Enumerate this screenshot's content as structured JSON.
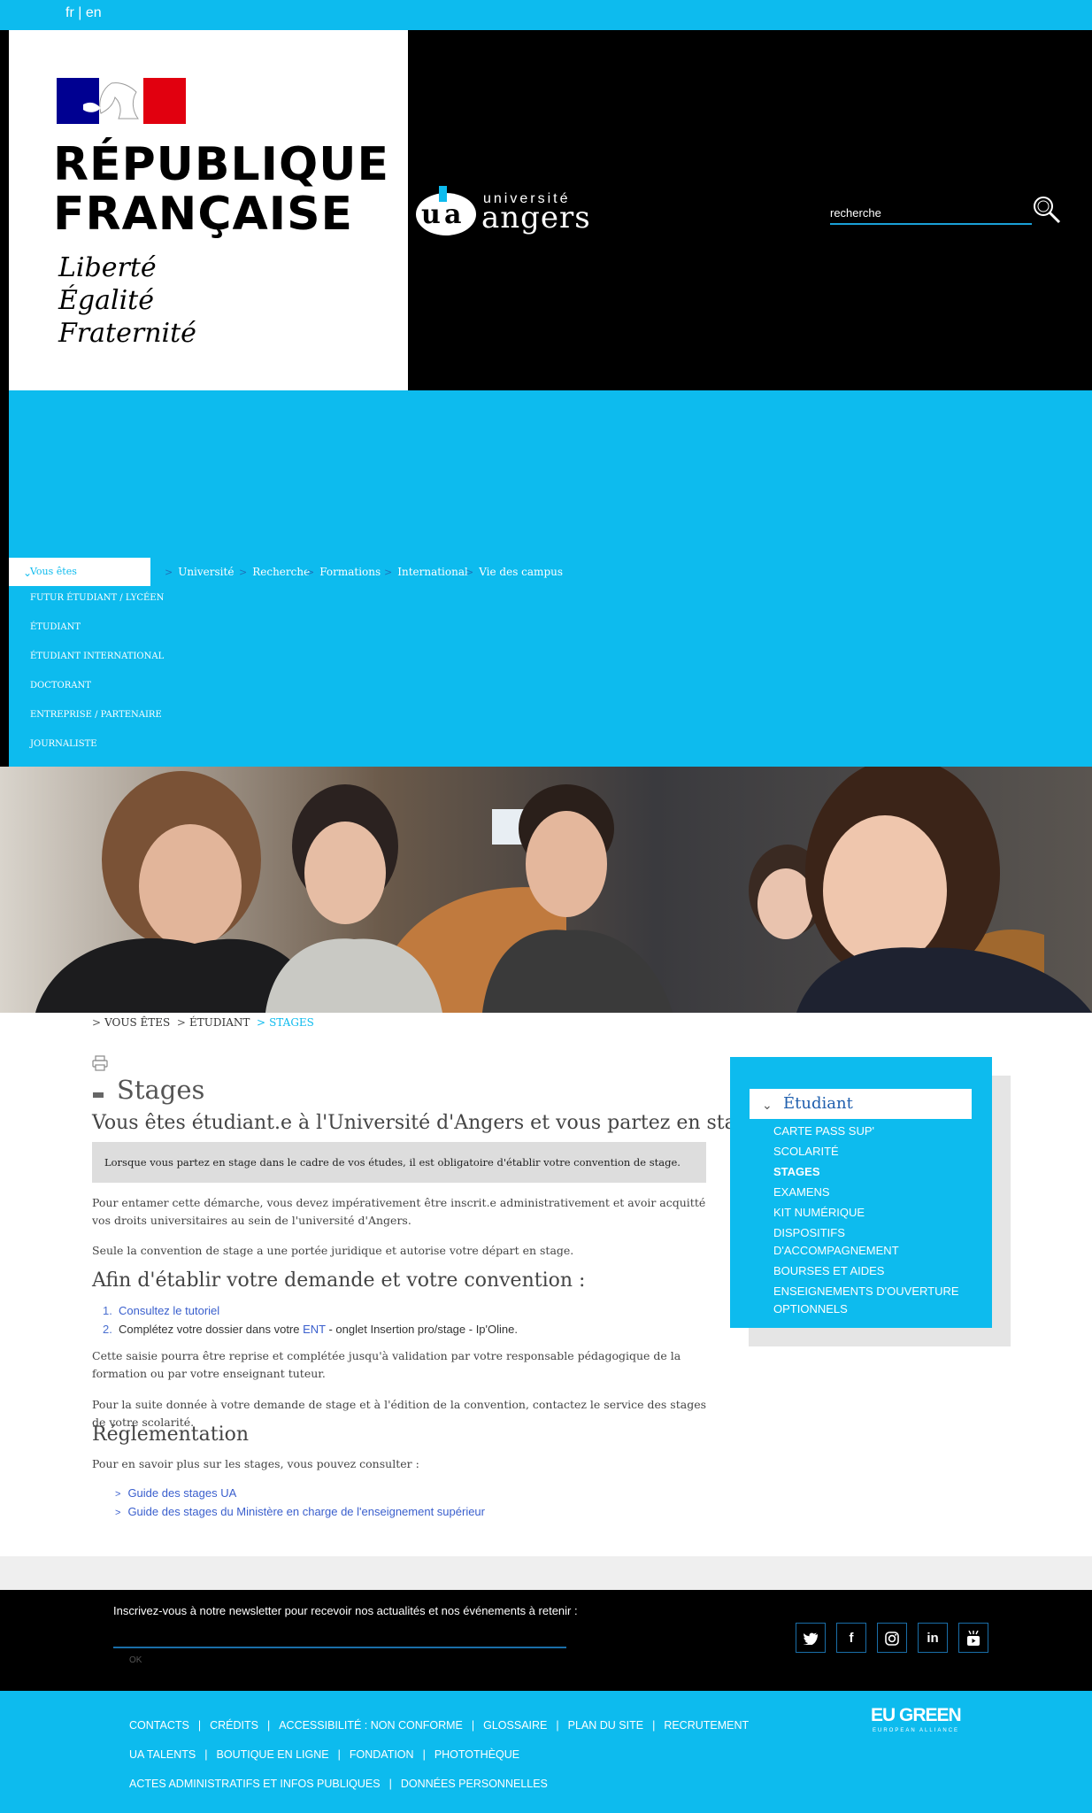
{
  "lang": {
    "fr": "fr",
    "sep": "|",
    "en": "en"
  },
  "header": {
    "rf_title_1": "RÉPUBLIQUE",
    "rf_title_2": "FRANÇAISE",
    "rf_motto_1": "Liberté",
    "rf_motto_2": "Égalité",
    "rf_motto_3": "Fraternité",
    "ua_small": "université",
    "ua_big": "angers",
    "search_placeholder": "recherche"
  },
  "nav": {
    "vous_etes": "Vous êtes",
    "top": [
      "Université",
      "Recherche",
      "Formations",
      "International",
      "Vie des campus"
    ],
    "sub": [
      "FUTUR ÉTUDIANT / LYCÉEN",
      "ÉTUDIANT",
      "ÉTUDIANT INTERNATIONAL",
      "DOCTORANT",
      "ENTREPRISE / PARTENAIRE",
      "JOURNALISTE"
    ]
  },
  "breadcrumb": {
    "gt": ">",
    "items": [
      "VOUS ÊTES",
      "ÉTUDIANT",
      "STAGES"
    ]
  },
  "main": {
    "title": "Stages",
    "h2": "Vous êtes étudiant.e à l'Université d'Angers et vous partez en stage?",
    "notice": "Lorsque vous partez en stage dans le cadre de vos études, il est obligatoire d'établir votre convention de stage.",
    "p1": "Pour entamer cette démarche, vous devez impérativement être inscrit.e administrativement et avoir acquitté vos droits universitaires au sein de l'université d'Angers.",
    "p2": "Seule la convention de stage a une portée juridique et autorise votre départ en stage.",
    "h3_afin": "Afin d'établir votre demande et votre convention :",
    "step1_num": "1.",
    "step1_link": "Consultez le tutoriel",
    "step2_num": "2.",
    "step2_before": "Complétez votre dossier dans votre ",
    "step2_link": "ENT",
    "step2_after": " - onglet Insertion pro/stage -  Ip'Oline.",
    "p3": "Cette saisie pourra être reprise et complétée jusqu'à validation par votre responsable pédagogique de la formation ou par votre enseignant tuteur.",
    "p4": "Pour la suite donnée à votre demande de stage et à l'édition de la convention, contactez le service des stages de votre scolarité.",
    "h3_reg": "Réglementation",
    "p5": "Pour en savoir plus sur les stages, vous pouvez consulter :",
    "guides_gt": ">",
    "guides": [
      "Guide des stages UA",
      "Guide des stages du Ministère en charge de l'enseignement supérieur"
    ]
  },
  "sidebar": {
    "heading": "Étudiant",
    "items": [
      "CARTE PASS SUP'",
      "SCOLARITÉ",
      "STAGES",
      "EXAMENS",
      "KIT NUMÉRIQUE",
      "DISPOSITIFS D'ACCOMPAGNEMENT",
      "BOURSES ET AIDES",
      "ENSEIGNEMENTS D'OUVERTURE OPTIONNELS"
    ],
    "active": "STAGES"
  },
  "newsletter": {
    "text": "Inscrivez-vous à notre newsletter pour recevoir nos actualités et nos événements à retenir :",
    "ok": "OK"
  },
  "social": {
    "twitter": "twitter-icon",
    "facebook": "facebook-icon",
    "instagram": "instagram-icon",
    "linkedin": "linkedin-icon",
    "youtube": "youtube-icon",
    "linkedin_glyph": "in",
    "facebook_glyph": "f"
  },
  "footer": {
    "sep": "|",
    "row1": [
      "CONTACTS",
      "CRÉDITS",
      "ACCESSIBILITÉ : NON CONFORME",
      "GLOSSAIRE",
      "PLAN DU SITE",
      "RECRUTEMENT"
    ],
    "row2": [
      "UA TALENTS",
      "BOUTIQUE EN LIGNE",
      "FONDATION",
      "PHOTOTHÈQUE"
    ],
    "row3": [
      "ACTES ADMINISTRATIFS ET INFOS PUBLIQUES",
      "DONNÉES PERSONNELLES"
    ],
    "eu_green": "EU GREEN",
    "eu_sub": "EUROPEAN ALLIANCE"
  },
  "colors": {
    "accent": "#0dbbee",
    "header_black": "#000000",
    "link": "#3a5fcd"
  }
}
